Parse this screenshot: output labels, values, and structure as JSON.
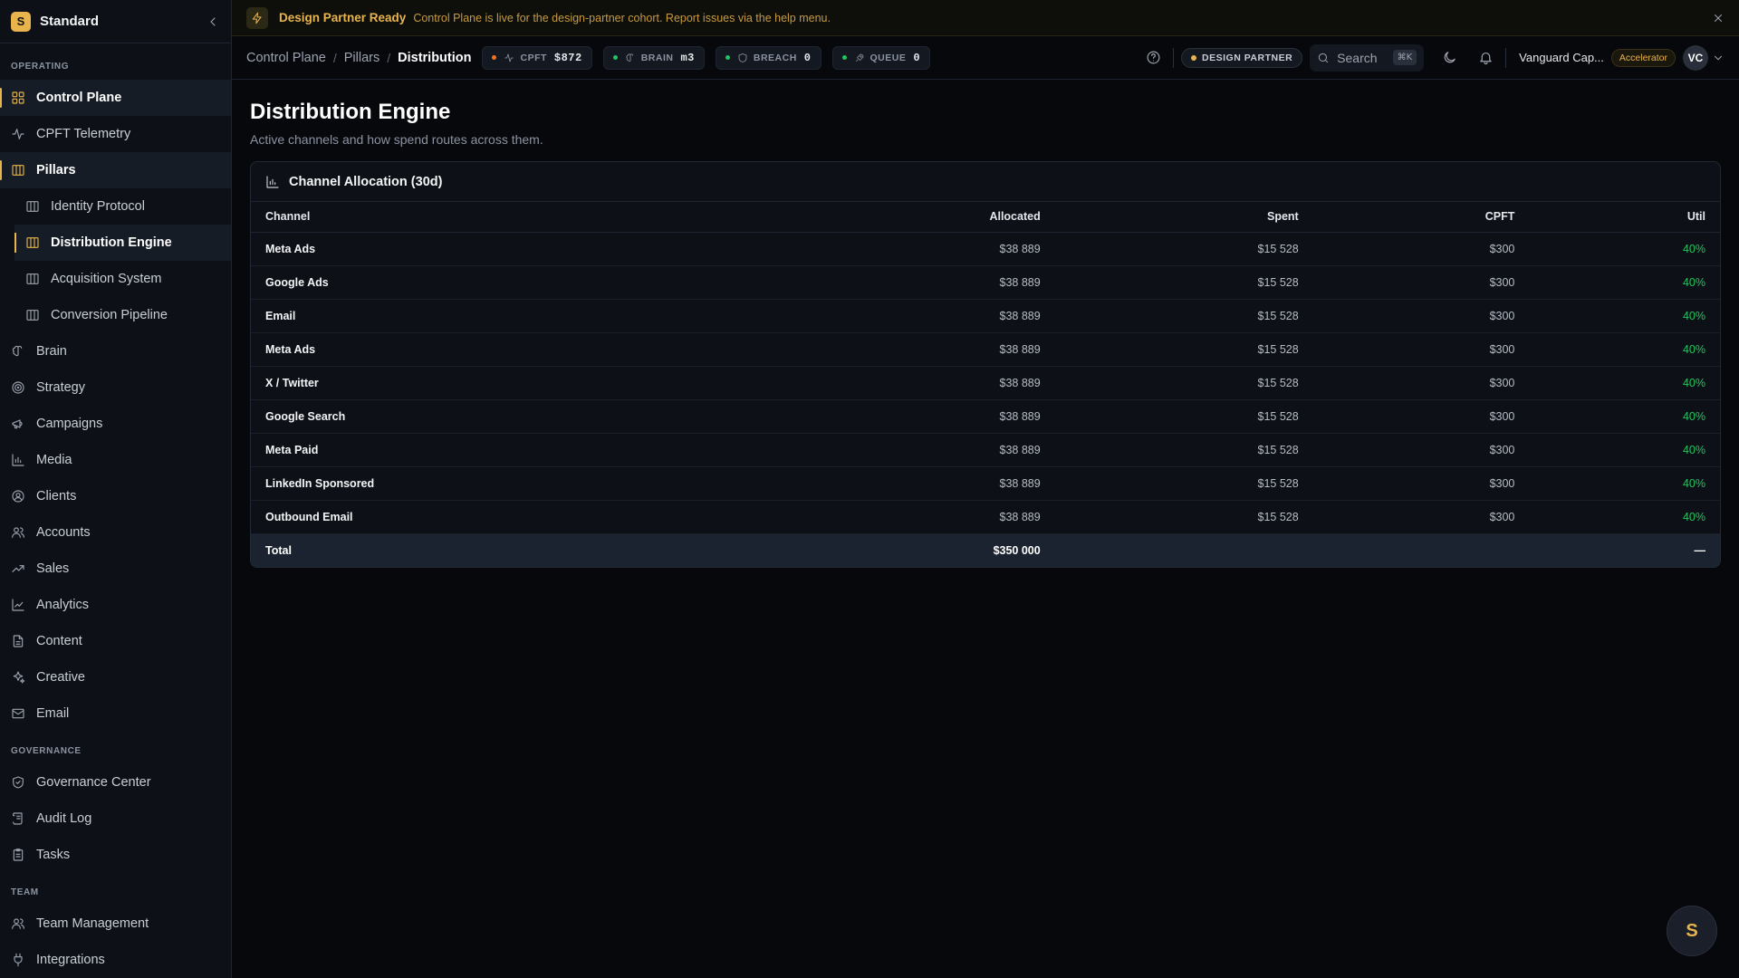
{
  "sidebar": {
    "brand": "Standard",
    "brand_initial": "S",
    "sections": {
      "operating": "OPERATING",
      "governance": "GOVERNANCE",
      "team": "TEAM"
    },
    "items": {
      "control_plane": "Control Plane",
      "cpft_telemetry": "CPFT Telemetry",
      "pillars": "Pillars",
      "identity_protocol": "Identity Protocol",
      "distribution_engine": "Distribution Engine",
      "acquisition_system": "Acquisition System",
      "conversion_pipeline": "Conversion Pipeline",
      "brain": "Brain",
      "strategy": "Strategy",
      "campaigns": "Campaigns",
      "media": "Media",
      "clients": "Clients",
      "accounts": "Accounts",
      "sales": "Sales",
      "analytics": "Analytics",
      "content": "Content",
      "creative": "Creative",
      "email": "Email",
      "governance_center": "Governance Center",
      "audit_log": "Audit Log",
      "tasks": "Tasks",
      "team_management": "Team Management",
      "integrations": "Integrations"
    }
  },
  "banner": {
    "title": "Design Partner Ready",
    "text": "Control Plane is live for the design-partner cohort. Report issues via the help menu."
  },
  "topbar": {
    "breadcrumb": [
      "Control Plane",
      "Pillars",
      "Distribution"
    ],
    "chips": [
      {
        "label": "CPFT",
        "value": "$872",
        "dot": "#f97316",
        "icon": "activity-icon"
      },
      {
        "label": "BRAIN",
        "value": "m3",
        "dot": "#22c55e",
        "icon": "brain-icon"
      },
      {
        "label": "BREACH",
        "value": "0",
        "dot": "#22c55e",
        "icon": "shield-icon"
      },
      {
        "label": "QUEUE",
        "value": "0",
        "dot": "#22c55e",
        "icon": "rocket-icon"
      }
    ],
    "partner_badge": "DESIGN PARTNER",
    "search_label": "Search",
    "search_shortcut": "⌘K",
    "org_name": "Vanguard Cap...",
    "tier": "Accelerator",
    "avatar": "VC"
  },
  "main": {
    "title": "Distribution Engine",
    "subtitle": "Active channels and how spend routes across them.",
    "card_title": "Channel Allocation (30d)",
    "columns": [
      "Channel",
      "Allocated",
      "Spent",
      "CPFT",
      "Util"
    ],
    "rows": [
      [
        "Meta Ads",
        "$38 889",
        "$15 528",
        "$300",
        "40%"
      ],
      [
        "Google Ads",
        "$38 889",
        "$15 528",
        "$300",
        "40%"
      ],
      [
        "Email",
        "$38 889",
        "$15 528",
        "$300",
        "40%"
      ],
      [
        "Meta Ads",
        "$38 889",
        "$15 528",
        "$300",
        "40%"
      ],
      [
        "X / Twitter",
        "$38 889",
        "$15 528",
        "$300",
        "40%"
      ],
      [
        "Google Search",
        "$38 889",
        "$15 528",
        "$300",
        "40%"
      ],
      [
        "Meta Paid",
        "$38 889",
        "$15 528",
        "$300",
        "40%"
      ],
      [
        "LinkedIn Sponsored",
        "$38 889",
        "$15 528",
        "$300",
        "40%"
      ],
      [
        "Outbound Email",
        "$38 889",
        "$15 528",
        "$300",
        "40%"
      ]
    ],
    "total": {
      "label": "Total",
      "allocated": "$350 000",
      "util": "—"
    }
  },
  "fab_label": "S",
  "colors": {
    "accent": "#e9b44c",
    "success": "#22c55e",
    "background": "#06080c"
  }
}
